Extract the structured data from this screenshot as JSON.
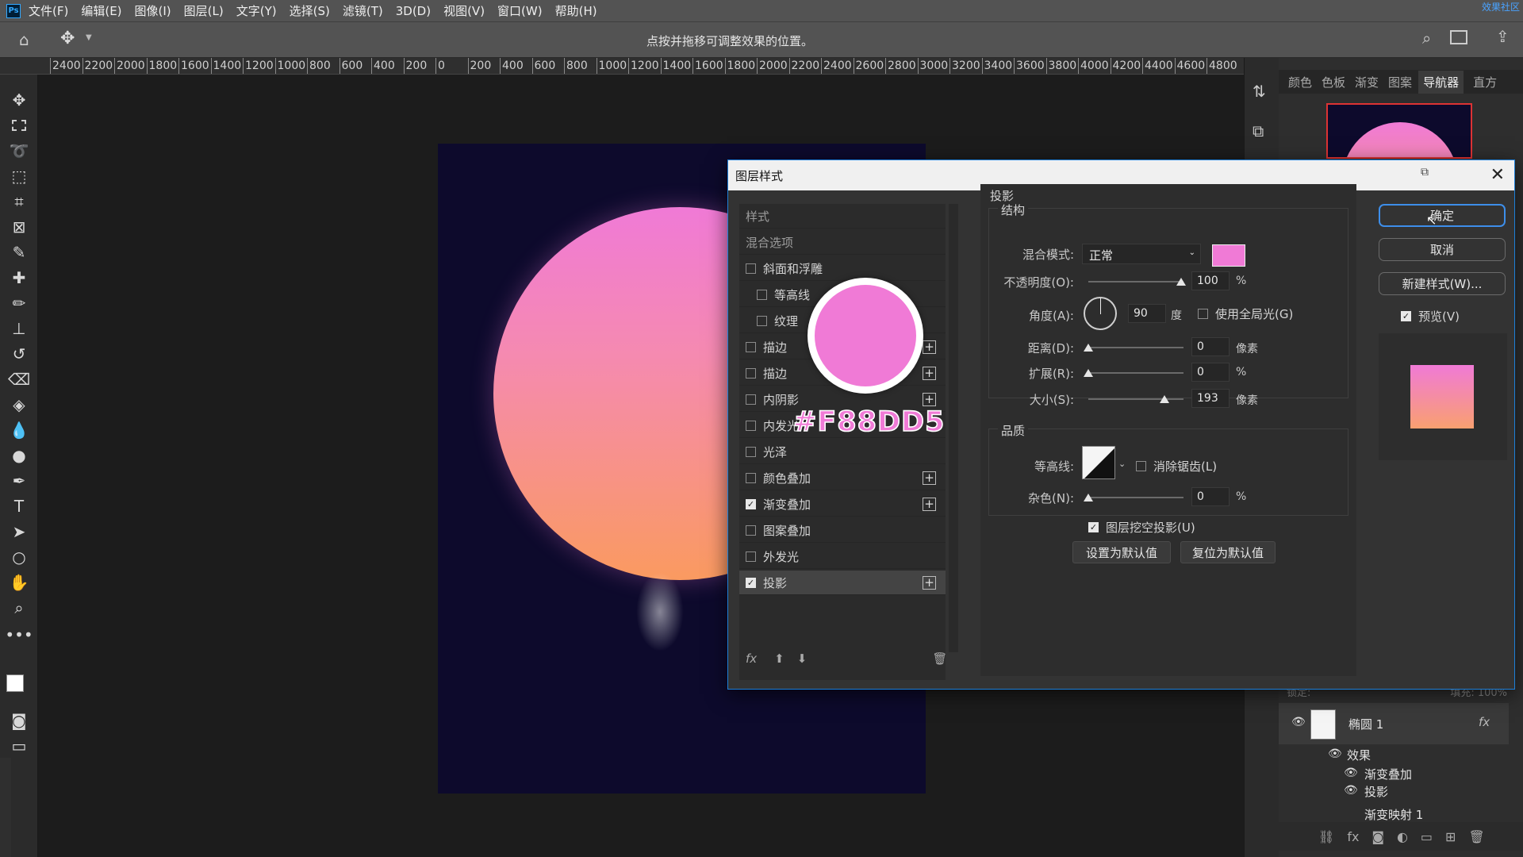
{
  "app": {
    "logo": "Ps",
    "watermark": "效果社区"
  },
  "menu": [
    "文件(F)",
    "编辑(E)",
    "图像(I)",
    "图层(L)",
    "文字(Y)",
    "选择(S)",
    "滤镜(T)",
    "3D(D)",
    "视图(V)",
    "窗口(W)",
    "帮助(H)"
  ],
  "options_bar": {
    "hint": "点按并拖移可调整效果的位置。"
  },
  "ruler": [
    "2400",
    "2200",
    "2000",
    "1800",
    "1600",
    "1400",
    "1200",
    "1000",
    "800",
    "600",
    "400",
    "200",
    "0",
    "200",
    "400",
    "600",
    "800",
    "1000",
    "1200",
    "1400",
    "1600",
    "1800",
    "2000",
    "2200",
    "2400",
    "2600",
    "2800",
    "3000",
    "3200",
    "3400",
    "3600",
    "3800",
    "4000",
    "4200",
    "4400",
    "4600",
    "4800"
  ],
  "right_panel": {
    "tabs": [
      "颜色",
      "色板",
      "渐变",
      "图案",
      "导航器",
      "直方"
    ],
    "active_tab": "导航器",
    "layers": {
      "lock_text": "锁定:",
      "fill_text": "填充: 100%",
      "layer_name": "椭圆 1",
      "fx": "fx",
      "effects_label": "效果",
      "effects": [
        "渐变叠加",
        "投影"
      ],
      "next_layer": "渐变映射 1"
    }
  },
  "dialog": {
    "title": "图层样式",
    "styles_header": "样式",
    "blend_options": "混合选项",
    "styles": [
      {
        "label": "斜面和浮雕",
        "checked": false,
        "indent": false,
        "plus": false
      },
      {
        "label": "等高线",
        "checked": false,
        "indent": true,
        "plus": false
      },
      {
        "label": "纹理",
        "checked": false,
        "indent": true,
        "plus": false
      },
      {
        "label": "描边",
        "checked": false,
        "indent": false,
        "plus": true
      },
      {
        "label": "描边",
        "checked": false,
        "indent": false,
        "plus": true
      },
      {
        "label": "内阴影",
        "checked": false,
        "indent": false,
        "plus": true
      },
      {
        "label": "内发光",
        "checked": false,
        "indent": false,
        "plus": false
      },
      {
        "label": "光泽",
        "checked": false,
        "indent": false,
        "plus": false
      },
      {
        "label": "颜色叠加",
        "checked": false,
        "indent": false,
        "plus": true
      },
      {
        "label": "渐变叠加",
        "checked": true,
        "indent": false,
        "plus": true
      },
      {
        "label": "图案叠加",
        "checked": false,
        "indent": false,
        "plus": false
      },
      {
        "label": "外发光",
        "checked": false,
        "indent": false,
        "plus": false
      },
      {
        "label": "投影",
        "checked": true,
        "indent": false,
        "plus": true,
        "selected": true
      }
    ],
    "footer_fx": "fx",
    "annotation_hex": "#F88DD5",
    "annotation_color": "#f07ad6",
    "section_title": "投影",
    "structure": {
      "title": "结构",
      "blend_mode_label": "混合模式:",
      "blend_mode_value": "正常",
      "swatch_color": "#f07ad6",
      "opacity_label": "不透明度(O):",
      "opacity_value": "100",
      "opacity_unit": "%",
      "angle_label": "角度(A):",
      "angle_value": "90",
      "angle_unit": "度",
      "global_light_label": "使用全局光(G)",
      "distance_label": "距离(D):",
      "distance_value": "0",
      "distance_unit": "像素",
      "spread_label": "扩展(R):",
      "spread_value": "0",
      "spread_unit": "%",
      "size_label": "大小(S):",
      "size_value": "193",
      "size_unit": "像素"
    },
    "quality": {
      "title": "品质",
      "contour_label": "等高线:",
      "antialias_label": "消除锯齿(L)",
      "noise_label": "杂色(N):",
      "noise_value": "0",
      "noise_unit": "%"
    },
    "knockout_label": "图层挖空投影(U)",
    "set_default": "设置为默认值",
    "reset_default": "复位为默认值",
    "buttons": {
      "ok": "确定",
      "cancel": "取消",
      "new_style": "新建样式(W)..."
    },
    "preview_label": "预览(V)"
  }
}
